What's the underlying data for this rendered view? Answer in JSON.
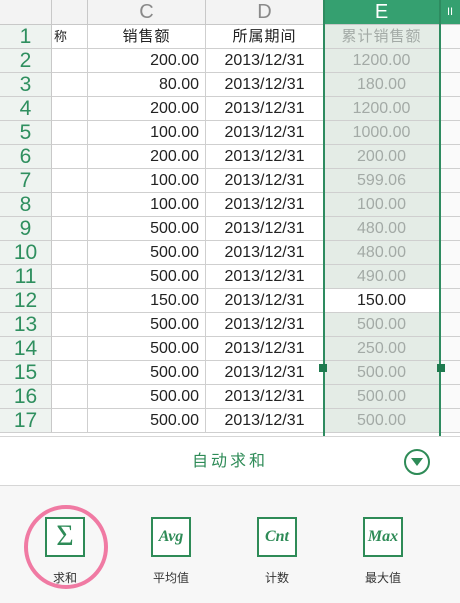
{
  "columns": {
    "c": "C",
    "d": "D",
    "e": "E",
    "f": "II"
  },
  "header_row": {
    "number": "1",
    "a": "称",
    "c": "销售额",
    "d": "所属期间",
    "e": "累计销售额"
  },
  "rows": [
    {
      "number": "2",
      "sales": "200.00",
      "period": "2013/12/31",
      "cumulative": "1200.00"
    },
    {
      "number": "3",
      "sales": "80.00",
      "period": "2013/12/31",
      "cumulative": "180.00"
    },
    {
      "number": "4",
      "sales": "200.00",
      "period": "2013/12/31",
      "cumulative": "1200.00"
    },
    {
      "number": "5",
      "sales": "100.00",
      "period": "2013/12/31",
      "cumulative": "1000.00"
    },
    {
      "number": "6",
      "sales": "200.00",
      "period": "2013/12/31",
      "cumulative": "200.00"
    },
    {
      "number": "7",
      "sales": "100.00",
      "period": "2013/12/31",
      "cumulative": "599.06"
    },
    {
      "number": "8",
      "sales": "100.00",
      "period": "2013/12/31",
      "cumulative": "100.00"
    },
    {
      "number": "9",
      "sales": "500.00",
      "period": "2013/12/31",
      "cumulative": "480.00"
    },
    {
      "number": "10",
      "sales": "500.00",
      "period": "2013/12/31",
      "cumulative": "480.00"
    },
    {
      "number": "11",
      "sales": "500.00",
      "period": "2013/12/31",
      "cumulative": "490.00"
    },
    {
      "number": "12",
      "sales": "150.00",
      "period": "2013/12/31",
      "cumulative": "150.00"
    },
    {
      "number": "13",
      "sales": "500.00",
      "period": "2013/12/31",
      "cumulative": "500.00"
    },
    {
      "number": "14",
      "sales": "500.00",
      "period": "2013/12/31",
      "cumulative": "250.00"
    },
    {
      "number": "15",
      "sales": "500.00",
      "period": "2013/12/31",
      "cumulative": "500.00"
    },
    {
      "number": "16",
      "sales": "500.00",
      "period": "2013/12/31",
      "cumulative": "500.00"
    },
    {
      "number": "17",
      "sales": "500.00",
      "period": "2013/12/31",
      "cumulative": "500.00"
    }
  ],
  "active_row": "12",
  "autosum": {
    "title": "自动求和"
  },
  "functions": [
    {
      "icon": "sigma-icon",
      "symbol": "Σ",
      "label": "求和"
    },
    {
      "icon": "avg-icon",
      "symbol": "Avg",
      "label": "平均值"
    },
    {
      "icon": "cnt-icon",
      "symbol": "Cnt",
      "label": "计数"
    },
    {
      "icon": "max-icon",
      "symbol": "Max",
      "label": "最大值"
    }
  ],
  "colors": {
    "accent": "#2e8b57",
    "selected_column": "#35a070",
    "highlight_ring": "#f07aa3"
  }
}
